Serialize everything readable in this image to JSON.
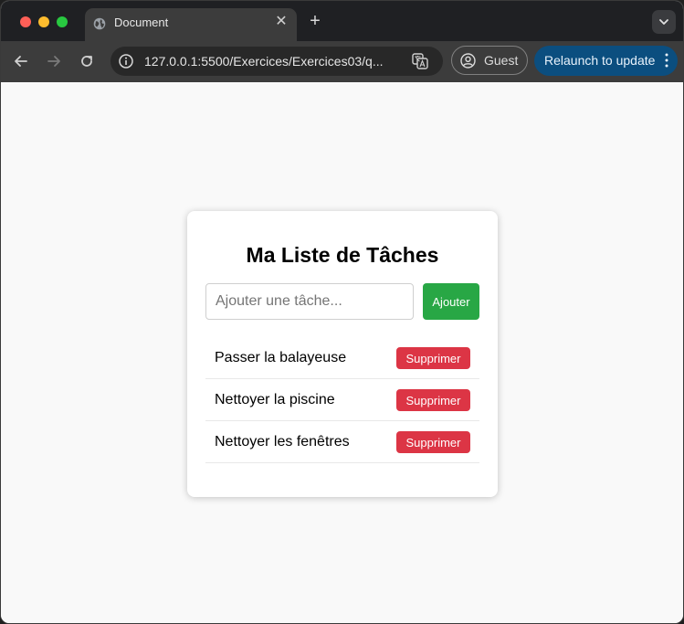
{
  "browser": {
    "tab": {
      "title": "Document"
    },
    "url": "127.0.0.1:5500/Exercices/Exercices03/q...",
    "profile_label": "Guest",
    "relaunch_label": "Relaunch to update"
  },
  "app": {
    "title": "Ma Liste de Tâches",
    "input": {
      "placeholder": "Ajouter une tâche...",
      "value": ""
    },
    "add_label": "Ajouter",
    "tasks": [
      {
        "label": "Passer la balayeuse",
        "delete_label": "Supprimer"
      },
      {
        "label": "Nettoyer la piscine",
        "delete_label": "Supprimer"
      },
      {
        "label": "Nettoyer les fenêtres",
        "delete_label": "Supprimer"
      }
    ]
  },
  "colors": {
    "accent_add": "#28a745",
    "accent_delete": "#dc3545",
    "relaunch_bg": "#0b4e7f"
  },
  "icons": [
    "globe-icon",
    "close-icon",
    "plus-icon",
    "chevron-down-icon",
    "back-arrow-icon",
    "forward-arrow-icon",
    "reload-icon",
    "site-info-icon",
    "translate-icon",
    "profile-icon",
    "more-vert-icon"
  ]
}
